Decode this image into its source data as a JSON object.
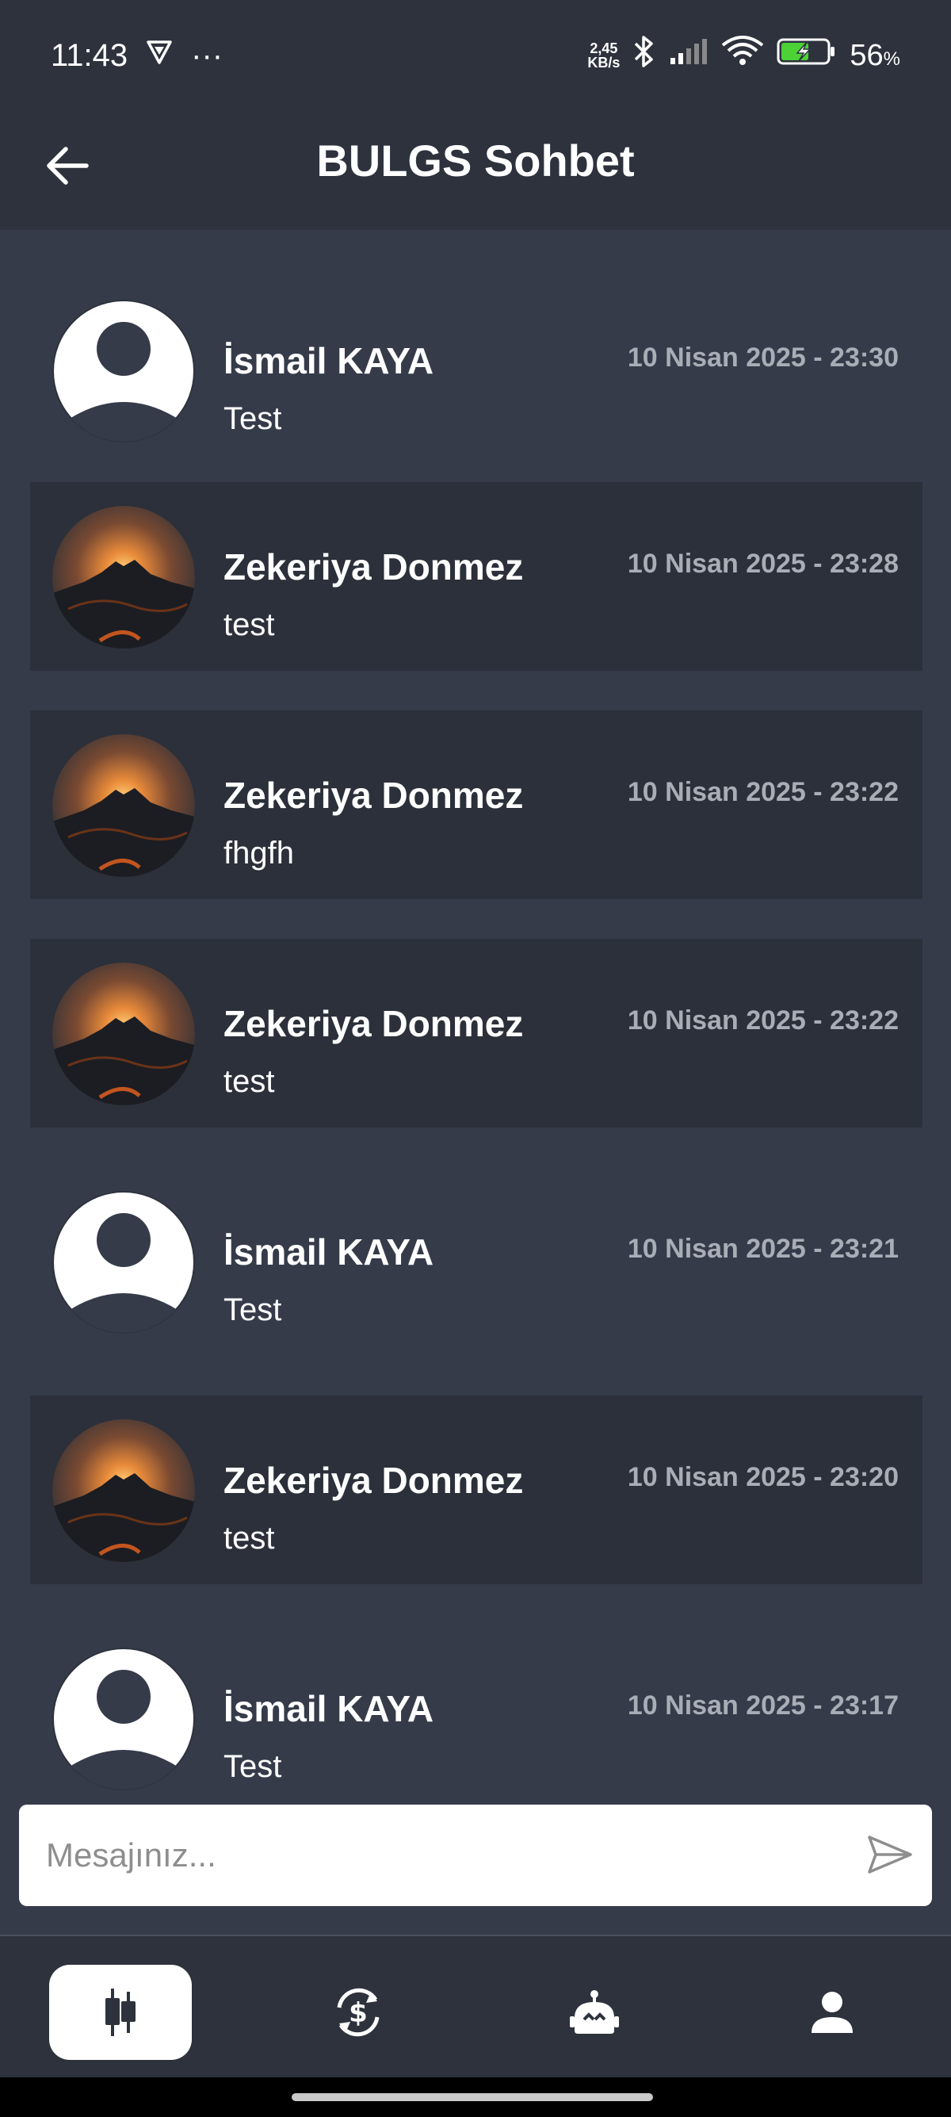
{
  "status_bar": {
    "time": "11:43",
    "more": "···",
    "net_speed_value": "2,45",
    "net_speed_unit": "KB/s",
    "battery_percent": "56",
    "battery_unit": "%"
  },
  "header": {
    "title": "BULGS Sohbet",
    "back_icon": "arrow-left-icon"
  },
  "messages": [
    {
      "name": "İsmail KAYA",
      "time": "10 Nisan 2025 - 23:30",
      "text": "Test",
      "avatar": "default-user"
    },
    {
      "name": "Zekeriya Donmez",
      "time": "10 Nisan 2025 - 23:28",
      "text": "test",
      "avatar": "mountain-sunset"
    },
    {
      "name": "Zekeriya Donmez",
      "time": "10 Nisan 2025 - 23:22",
      "text": "fhgfh",
      "avatar": "mountain-sunset"
    },
    {
      "name": "Zekeriya Donmez",
      "time": "10 Nisan 2025 - 23:22",
      "text": "test",
      "avatar": "mountain-sunset"
    },
    {
      "name": "İsmail KAYA",
      "time": "10 Nisan 2025 - 23:21",
      "text": "Test",
      "avatar": "default-user"
    },
    {
      "name": "Zekeriya Donmez",
      "time": "10 Nisan 2025 - 23:20",
      "text": "test",
      "avatar": "mountain-sunset"
    },
    {
      "name": "İsmail KAYA",
      "time": "10 Nisan 2025 - 23:17",
      "text": "Test",
      "avatar": "default-user"
    }
  ],
  "composer": {
    "placeholder": "Mesajınız...",
    "value": "",
    "send_icon": "send-icon"
  },
  "bottom_nav": [
    {
      "icon": "candlestick-chart-icon",
      "active": true
    },
    {
      "icon": "currency-exchange-icon",
      "active": false
    },
    {
      "icon": "robot-icon",
      "active": false
    },
    {
      "icon": "person-icon",
      "active": false
    }
  ],
  "colors": {
    "background": "#363b4a",
    "bar": "#2d323d",
    "alt_row": "#2b303a",
    "time_text": "#a9adb6",
    "white": "#ffffff"
  }
}
